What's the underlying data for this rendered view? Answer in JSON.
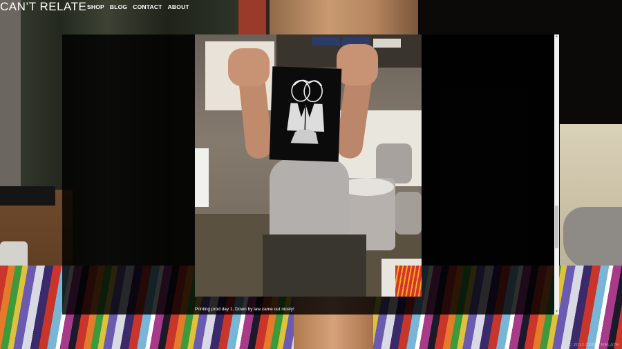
{
  "site": {
    "logo": "CAN’T RELATE",
    "copyright": "© 2012 CAN'T RELATE"
  },
  "nav": {
    "items": [
      {
        "label": "SHOP"
      },
      {
        "label": "BLOG"
      },
      {
        "label": "CONTACT"
      },
      {
        "label": "ABOUT"
      }
    ]
  },
  "lightbox": {
    "caption": "Printing prod day 1. Down by law came out nicely!"
  },
  "scrollbar": {
    "up_icon": "up-arrow-icon",
    "down_icon": "down-arrow-icon"
  }
}
